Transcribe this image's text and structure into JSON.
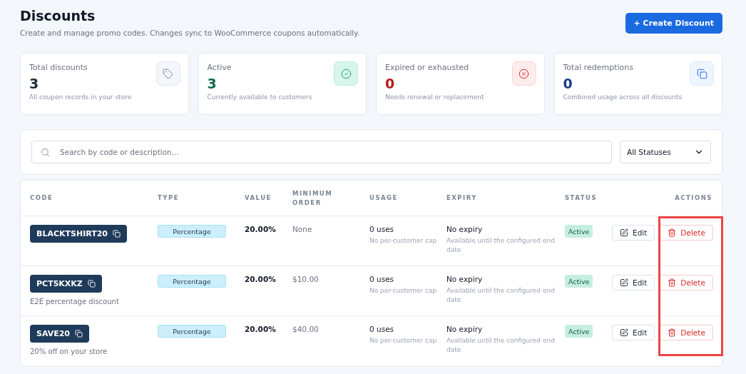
{
  "header": {
    "title": "Discounts",
    "subtitle": "Create and manage promo codes. Changes sync to WooCommerce coupons automatically.",
    "create_button": "+ Create Discount"
  },
  "stats": [
    {
      "label": "Total discounts",
      "value": "3",
      "note": "All coupon records in your store",
      "kind": "tag",
      "color": "#1f2937"
    },
    {
      "label": "Active",
      "value": "3",
      "note": "Currently available to customers",
      "kind": "check",
      "color": "#0f6b52"
    },
    {
      "label": "Expired or exhausted",
      "value": "0",
      "note": "Needs renewal or replacement",
      "kind": "cross",
      "color": "#b91c1c"
    },
    {
      "label": "Total redemptions",
      "value": "0",
      "note": "Combined usage across all discounts",
      "kind": "copy",
      "color": "#1e3a8a"
    }
  ],
  "filters": {
    "search": {
      "placeholder": "Search by code or description..."
    },
    "status_select": "All Statuses"
  },
  "table": {
    "columns": [
      "CODE",
      "TYPE",
      "VALUE",
      "MINIMUM ORDER",
      "USAGE",
      "EXPIRY",
      "STATUS",
      "ACTIONS"
    ],
    "rows": [
      {
        "code": "BLACKTSHIRT20",
        "description": null,
        "type": "Percentage",
        "value": "20.00%",
        "minimum": "None",
        "usage": "0 uses",
        "usage_note": "No per-customer cap",
        "expiry": "No expiry",
        "expiry_note": "Available until the configured end date",
        "status": "Active",
        "edit": "Edit",
        "delete": "Delete"
      },
      {
        "code": "PCT5KXKZ",
        "description": "E2E percentage discount",
        "type": "Percentage",
        "value": "20.00%",
        "minimum": "$10.00",
        "usage": "0 uses",
        "usage_note": "No per-customer cap",
        "expiry": "No expiry",
        "expiry_note": "Available until the configured end date",
        "status": "Active",
        "edit": "Edit",
        "delete": "Delete"
      },
      {
        "code": "SAVE20",
        "description": "20% off on your store",
        "type": "Percentage",
        "value": "20.00%",
        "minimum": "$40.00",
        "usage": "0 uses",
        "usage_note": "No per-customer cap",
        "expiry": "No expiry",
        "expiry_note": "Available until the configured end date",
        "status": "Active",
        "edit": "Edit",
        "delete": "Delete"
      }
    ],
    "delete_column_highlighted": true
  }
}
